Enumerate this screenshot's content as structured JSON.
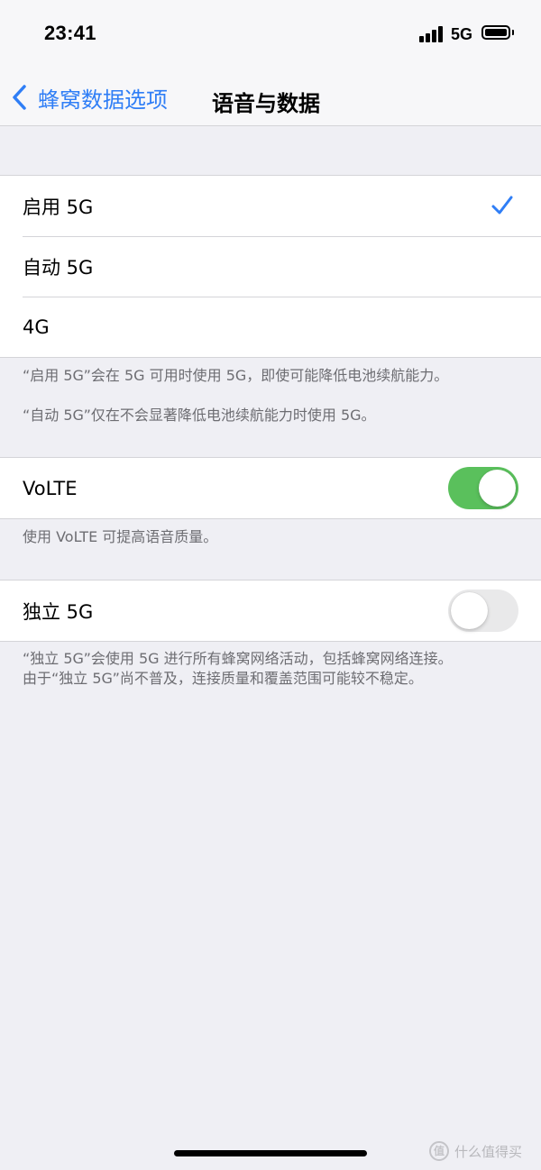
{
  "status_bar": {
    "time": "23:41",
    "network": "5G",
    "signal_bars": 4
  },
  "nav": {
    "back_label": "蜂窝数据选项",
    "title": "语音与数据"
  },
  "mode_options": [
    {
      "label": "启用 5G",
      "selected": true
    },
    {
      "label": "自动 5G",
      "selected": false
    },
    {
      "label": "4G",
      "selected": false
    }
  ],
  "mode_footnotes": [
    "“启用 5G”会在 5G 可用时使用 5G，即使可能降低电池续航能力。",
    "“自动 5G”仅在不会显著降低电池续航能力时使用 5G。"
  ],
  "volte": {
    "label": "VoLTE",
    "enabled": true,
    "footnote": "使用 VoLTE 可提高语音质量。"
  },
  "sa5g": {
    "label": "独立 5G",
    "enabled": false,
    "footnote_lines": [
      "“独立 5G”会使用 5G 进行所有蜂窝网络活动，包括蜂窝网络连接。",
      "由于“独立 5G”尚不普及，连接质量和覆盖范围可能较不稳定。"
    ]
  },
  "watermark": {
    "icon_glyph": "值",
    "text": "什么值得买"
  },
  "colors": {
    "accent": "#2f7ef6",
    "toggle_on": "#5ac05c",
    "toggle_off": "#e9e9ea",
    "background": "#efeff4"
  }
}
